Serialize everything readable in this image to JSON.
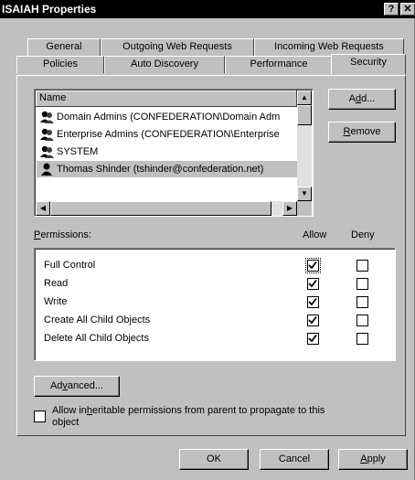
{
  "window": {
    "title": "ISAIAH Properties",
    "help_glyph": "?",
    "close_glyph": "✕"
  },
  "tabs": {
    "row1": [
      "General",
      "Outgoing Web Requests",
      "Incoming Web Requests"
    ],
    "row2": [
      "Policies",
      "Auto Discovery",
      "Performance",
      "Security"
    ],
    "active": "Security"
  },
  "users": {
    "column_header": "Name",
    "items": [
      {
        "name": "Domain Admins (CONFEDERATION\\Domain Adm",
        "icon": "group-icon",
        "selected": false
      },
      {
        "name": "Enterprise Admins (CONFEDERATION\\Enterprise",
        "icon": "group-icon",
        "selected": false
      },
      {
        "name": "SYSTEM",
        "icon": "group-icon",
        "selected": false
      },
      {
        "name": "Thomas Shinder (tshinder@confederation.net)",
        "icon": "user-icon",
        "selected": true
      }
    ],
    "add_button": {
      "before": "A",
      "key": "d",
      "after": "d..."
    },
    "remove_button": {
      "before": "",
      "key": "R",
      "after": "emove"
    }
  },
  "permissions": {
    "label": {
      "before": "",
      "key": "P",
      "after": "ermissions:"
    },
    "allow_header": "Allow",
    "deny_header": "Deny",
    "rows": [
      {
        "name": "Full Control",
        "allow": true,
        "deny": false
      },
      {
        "name": "Read",
        "allow": true,
        "deny": false
      },
      {
        "name": "Write",
        "allow": true,
        "deny": false
      },
      {
        "name": "Create All Child Objects",
        "allow": true,
        "deny": false
      },
      {
        "name": "Delete All Child Objects",
        "allow": true,
        "deny": false
      }
    ]
  },
  "advanced_button": {
    "before": "Ad",
    "key": "v",
    "after": "anced..."
  },
  "inherit": {
    "checked": false,
    "line1_before": "Allow in",
    "line1_key": "h",
    "line1_after": "eritable permissions from parent to propagate to this",
    "line2": "object"
  },
  "footer": {
    "ok": "OK",
    "cancel": "Cancel",
    "apply": {
      "before": "",
      "key": "A",
      "after": "pply"
    }
  }
}
